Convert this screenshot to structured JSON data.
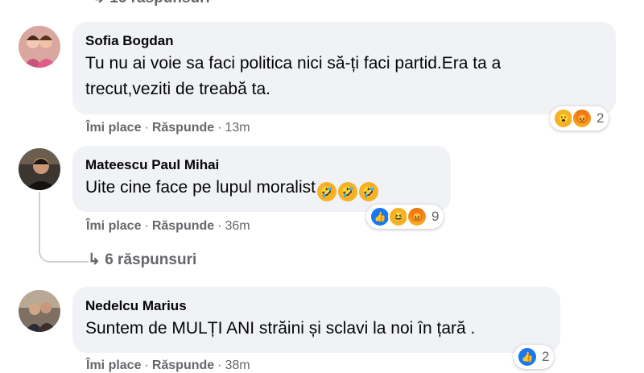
{
  "top_partial": {
    "label": "16 răspunsuri"
  },
  "comments": [
    {
      "author": "Sofia Bogdan",
      "text_line1": "Tu nu ai voie sa faci politica nici să-ți faci partid.Era ta a",
      "text_line2": "trecut,veziti de treabă ta.",
      "like": "Îmi place",
      "reply": "Răspunde",
      "time": "13m",
      "reaction_count": "2"
    },
    {
      "author": "Mateescu Paul Mihai",
      "text": "Uite cine face pe lupul moralist",
      "like": "Îmi place",
      "reply": "Răspunde",
      "time": "36m",
      "reaction_count": "9",
      "replies_label": "6 răspunsuri"
    },
    {
      "author": "Nedelcu Marius",
      "text": "Suntem de MULȚI ANI străini și sclavi la noi în țară .",
      "like": "Îmi place",
      "reply": "Răspunde",
      "time": "38m",
      "reaction_count": "2"
    }
  ],
  "colors": {
    "bubble": "#f0f2f5",
    "meta": "#65676b",
    "like_blue": "#1877f2"
  }
}
